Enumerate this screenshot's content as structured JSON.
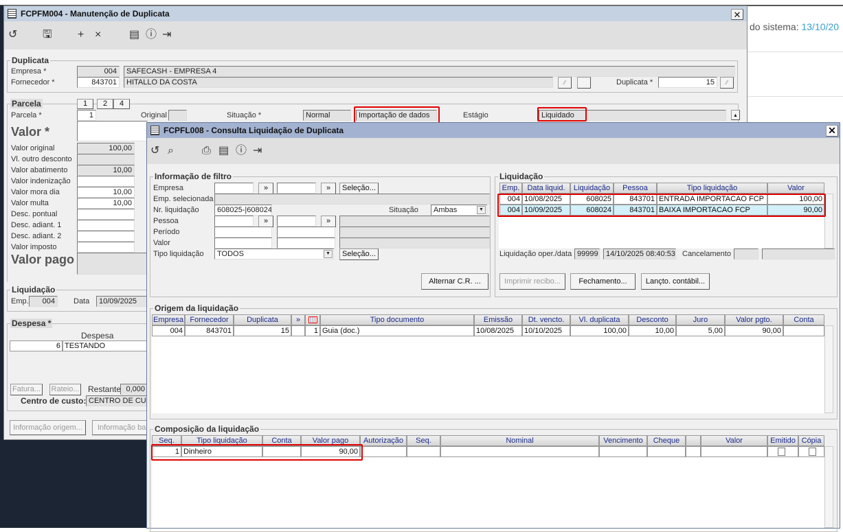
{
  "background": {
    "system_date_label": "do sistema:",
    "system_date": "13/10/20"
  },
  "main_window": {
    "title": "FCPFM004 - Manutenção de Duplicata",
    "toolbar": [
      "refresh-icon",
      "save-icon",
      "add-icon",
      "delete-icon",
      "calendar-icon",
      "help-icon",
      "exit-icon"
    ],
    "duplicata": {
      "legend": "Duplicata",
      "empresa_label": "Empresa *",
      "empresa_code": "004",
      "empresa_name": "SAFECASH -  EMPRESA 4",
      "fornecedor_label": "Fornecedor *",
      "fornecedor_code": "843701",
      "fornecedor_name": "HITALLO DA COSTA",
      "duplicata_label": "Duplicata *",
      "duplicata_value": "15"
    },
    "parcela": {
      "legend": "Parcela",
      "tabs": [
        "1",
        "2",
        "4"
      ],
      "parcela_label": "Parcela *",
      "parcela_value": "1",
      "original_label": "Original",
      "situacao_label": "Situação *",
      "situacao_value": "Normal",
      "origem_value": "Importação de dados",
      "estagio_label": "Estágio",
      "estagio_value": "Liquidado",
      "valor_label": "Valor *",
      "rows": [
        {
          "label": "Valor original",
          "value": "100,00",
          "ro": true
        },
        {
          "label": "Vl. outro desconto",
          "value": "",
          "ro": true
        },
        {
          "label": "Valor abatimento",
          "value": "10,00",
          "ro": true
        },
        {
          "label": "Valor indenização",
          "value": ""
        },
        {
          "label": "Valor mora dia",
          "value": "10,00"
        },
        {
          "label": "Valor multa",
          "value": "10,00"
        },
        {
          "label": "Desc. pontual",
          "value": ""
        },
        {
          "label": "Desc. adiant. 1",
          "value": ""
        },
        {
          "label": "Desc. adiant. 2",
          "value": ""
        },
        {
          "label": "Valor imposto",
          "value": ""
        }
      ],
      "valor_pago_label": "Valor pago"
    },
    "liquidacao": {
      "legend": "Liquidação",
      "emp_label": "Emp.",
      "emp_value": "004",
      "data_label": "Data",
      "data_value": "10/09/2025"
    },
    "despesa": {
      "legend": "Despesa *",
      "header": "Despesa",
      "code": "6",
      "name": "TESTANDO",
      "fatura": "Fatura...",
      "rateio": "Rateio...",
      "restante_label": "Restante",
      "restante_value": "0,000",
      "centro_label": "Centro de custo:",
      "centro_value": "CENTRO DE CUST"
    },
    "buttons": {
      "info_origem": "Informação origem...",
      "info_ba": "Informação ba"
    }
  },
  "dialog": {
    "title": "FCPFL008 - Consulta Liquidação de Duplicata",
    "toolbar": [
      "refresh-icon",
      "search-icon",
      "print-icon",
      "calendar-icon",
      "help-icon",
      "exit-icon"
    ],
    "filtro": {
      "legend": "Informação de filtro",
      "empresa": "Empresa",
      "emp_sel": "Emp. selecionada",
      "nr_liq": "Nr. liquidação",
      "nr_liq_value": "608025-|608024",
      "situacao": "Situação",
      "situacao_value": "Ambas",
      "pessoa": "Pessoa",
      "periodo": "Período",
      "valor": "Valor",
      "tipo_liq": "Tipo liquidação",
      "tipo_liq_value": "TODOS",
      "selecao": "Seleção...",
      "more": "»",
      "alternar": "Alternar C.R. ..."
    },
    "liquidacao": {
      "legend": "Liquidação",
      "columns": [
        "Emp.",
        "Data liquid.",
        "Liquidação",
        "Pessoa",
        "Tipo liquidação",
        "Valor"
      ],
      "rows": [
        [
          "004",
          "10/08/2025",
          "608025",
          "843701",
          "ENTRADA IMPORTACAO FCP",
          "100,00"
        ],
        [
          "004",
          "10/09/2025",
          "608024",
          "843701",
          "BAIXA IMPORTACAO FCP",
          "90,00"
        ]
      ],
      "selected_row": 1,
      "oper_label": "Liquidação oper./data",
      "oper_user": "99999",
      "oper_date": "14/10/2025 08:40:53",
      "cancel_label": "Cancelamento",
      "imprimir": "Imprimir recibo...",
      "fechamento": "Fechamento...",
      "lancto": "Lançto. contábil..."
    },
    "origem": {
      "legend": "Origem da liquidação",
      "columns": [
        "Empresa",
        "Fornecedor",
        "Duplicata",
        "»",
        "",
        "Tipo documento",
        "Emissão",
        "Dt. vencto.",
        "Vl. duplicata",
        "Desconto",
        "Juro",
        "Valor  pgto.",
        "Conta"
      ],
      "rows": [
        [
          "004",
          "843701",
          "15",
          "",
          "1",
          "Guia (doc.)",
          "10/08/2025",
          "10/10/2025",
          "100,00",
          "10,00",
          "5,00",
          "90,00",
          ""
        ]
      ]
    },
    "composicao": {
      "legend": "Composição da liquidação",
      "columns": [
        "Seq.",
        "Tipo liquidação",
        "Conta",
        "Valor pago",
        "Autorização",
        "Seq.",
        "Nominal",
        "Vencimento",
        "Cheque",
        "",
        "Valor",
        "Emitido",
        "Cópia"
      ],
      "rows": [
        [
          "1",
          "Dinheiro",
          "",
          "90,00",
          "",
          "",
          "",
          "",
          "",
          "",
          "",
          "",
          ""
        ]
      ]
    }
  },
  "colors": {
    "highlight": "#e00000",
    "selected_row": "#d2f0fa",
    "date_link": "#3a9fd0"
  }
}
